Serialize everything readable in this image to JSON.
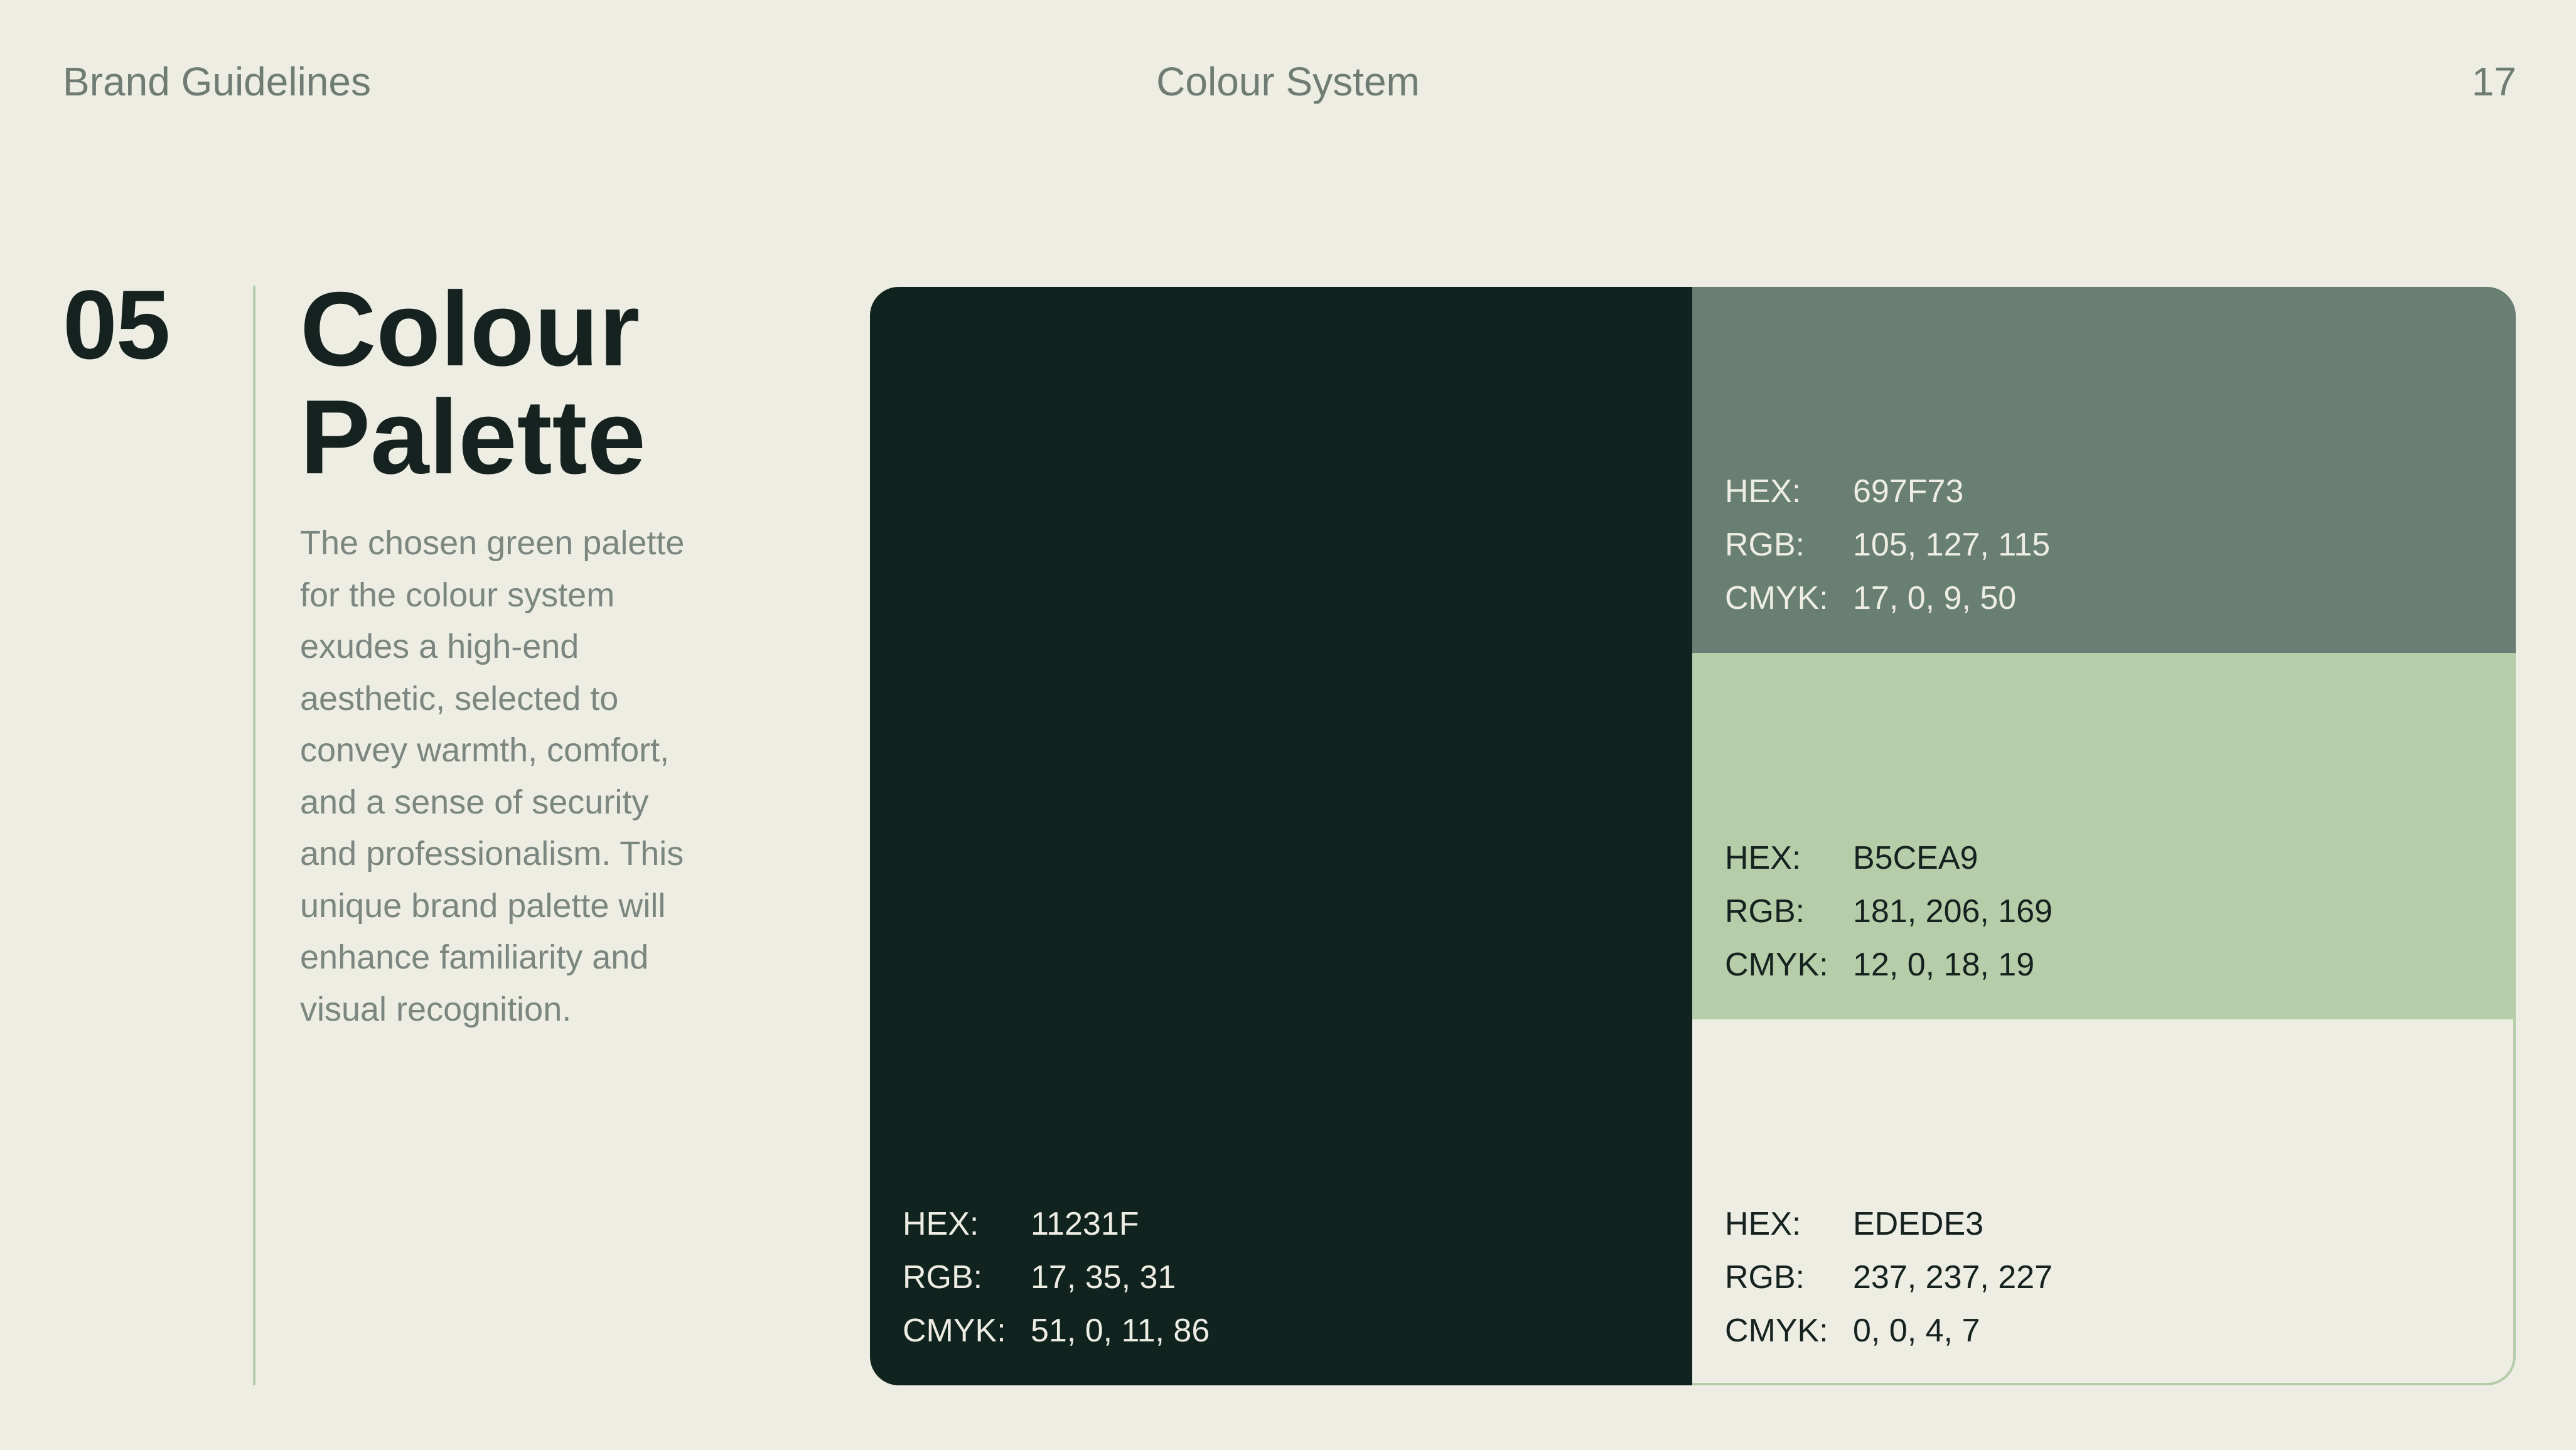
{
  "header": {
    "left": "Brand Guidelines",
    "center": "Colour System",
    "page_number": "17"
  },
  "section": {
    "number": "05",
    "title_line1": "Colour",
    "title_line2": "Palette",
    "body": "The chosen green palette for the colour system exudes a high-end aesthetic, selected to convey warmth, comfort, and a sense of security and professionalism. This unique brand palette will enhance familiarity and visual recognition."
  },
  "labels": {
    "hex": "HEX:",
    "rgb": "RGB:",
    "cmyk": "CMYK:"
  },
  "swatches": [
    {
      "hex": "11231F",
      "rgb": "17, 35, 31",
      "cmyk": "51, 0, 11, 86"
    },
    {
      "hex": "697F73",
      "rgb": "105, 127, 115",
      "cmyk": "17, 0, 9, 50"
    },
    {
      "hex": "B5CEA9",
      "rgb": "181, 206, 169",
      "cmyk": "12, 0, 18, 19"
    },
    {
      "hex": "EDEDE3",
      "rgb": "237, 237, 227",
      "cmyk": "0, 0, 4, 7"
    }
  ],
  "colors": {
    "background": "#EDEDE3",
    "text_dark": "#15221F",
    "text_muted": "#6F7C73",
    "accent_line": "#B5CEA9"
  }
}
